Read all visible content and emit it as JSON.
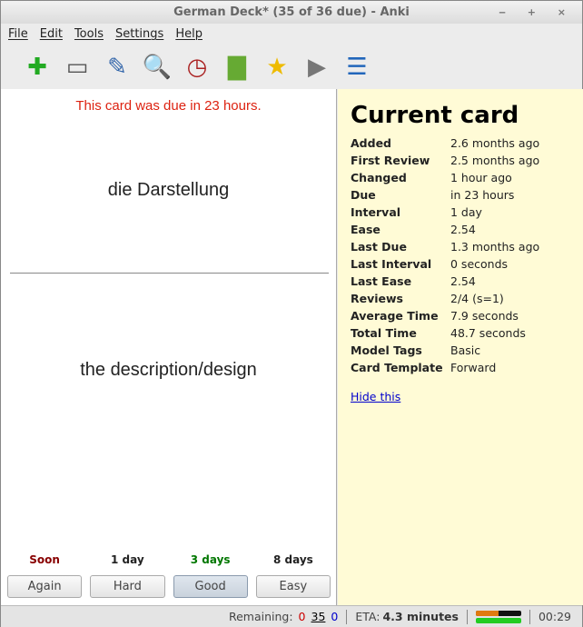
{
  "window": {
    "title": "German Deck* (35 of 36 due) - Anki",
    "controls": "‒ + ×"
  },
  "menu": [
    "File",
    "Edit",
    "Tools",
    "Settings",
    "Help"
  ],
  "toolbar": [
    {
      "name": "add-icon",
      "glyph": "✚",
      "color": "#2a2"
    },
    {
      "name": "edit-current-icon",
      "glyph": "▭",
      "color": "#555"
    },
    {
      "name": "deck-properties-icon",
      "glyph": "✎",
      "color": "#36a"
    },
    {
      "name": "browse-icon",
      "glyph": "🔍",
      "color": "#888"
    },
    {
      "name": "timebox-icon",
      "glyph": "◷",
      "color": "#a22"
    },
    {
      "name": "statistics-icon",
      "glyph": "▇",
      "color": "#6a3"
    },
    {
      "name": "mark-icon",
      "glyph": "★",
      "color": "#eb0"
    },
    {
      "name": "replay-audio-icon",
      "glyph": "▶",
      "color": "#777"
    },
    {
      "name": "card-info-icon",
      "glyph": "☰",
      "color": "#26b"
    }
  ],
  "card": {
    "due_message": "This card was due in 23 hours.",
    "front": "die Darstellung",
    "back": "the description/design"
  },
  "answers": [
    {
      "ease": "Soon",
      "label": "Again",
      "color": "#800"
    },
    {
      "ease": "1 day",
      "label": "Hard",
      "color": "#000"
    },
    {
      "ease": "3 days",
      "label": "Good",
      "color": "#070"
    },
    {
      "ease": "8 days",
      "label": "Easy",
      "color": "#000"
    }
  ],
  "info": {
    "title": "Current card",
    "rows": [
      [
        "Added",
        "2.6 months ago"
      ],
      [
        "First Review",
        "2.5 months ago"
      ],
      [
        "Changed",
        "1 hour ago"
      ],
      [
        "Due",
        "in 23 hours"
      ],
      [
        "Interval",
        "1 day"
      ],
      [
        "Ease",
        "2.54"
      ],
      [
        "Last Due",
        "1.3 months ago"
      ],
      [
        "Last Interval",
        "0 seconds"
      ],
      [
        "Last Ease",
        "2.54"
      ],
      [
        "Reviews",
        "2/4 (s=1)"
      ],
      [
        "Average Time",
        "7.9 seconds"
      ],
      [
        "Total Time",
        "48.7 seconds"
      ],
      [
        "Model Tags",
        "Basic"
      ],
      [
        "Card Template",
        "Forward"
      ]
    ],
    "hide_link": "Hide this"
  },
  "status": {
    "remaining_label": "Remaining:",
    "failed": "0",
    "review": "35",
    "new": "0",
    "eta_label": "ETA:",
    "eta": "4.3 minutes",
    "timer": "00:29",
    "progress_session": 0.5,
    "progress_deck": 1.0
  }
}
